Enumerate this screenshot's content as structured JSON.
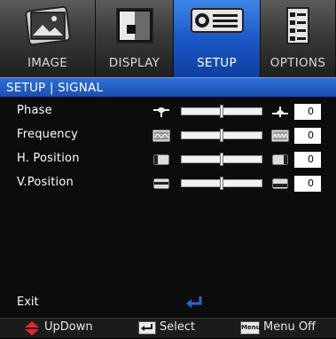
{
  "tabs": [
    {
      "label": "IMAGE",
      "icon": "image-icon"
    },
    {
      "label": "DISPLAY",
      "icon": "display-icon"
    },
    {
      "label": "SETUP",
      "icon": "projector-icon"
    },
    {
      "label": "OPTIONS",
      "icon": "options-icon"
    }
  ],
  "active_tab": "SETUP",
  "section_title": "SETUP | SIGNAL",
  "rows": [
    {
      "label": "Phase",
      "value": "0",
      "level": 0.5,
      "left_icon": "phase-low-icon",
      "right_icon": "phase-high-icon"
    },
    {
      "label": "Frequency",
      "value": "0",
      "level": 0.5,
      "left_icon": "frequency-low-icon",
      "right_icon": "frequency-high-icon"
    },
    {
      "label": "H. Position",
      "value": "0",
      "level": 0.5,
      "left_icon": "h-position-left-icon",
      "right_icon": "h-position-right-icon"
    },
    {
      "label": "V.Position",
      "value": "0",
      "level": 0.5,
      "left_icon": "v-position-down-icon",
      "right_icon": "v-position-up-icon"
    }
  ],
  "exit_label": "Exit",
  "footer": {
    "updown_label": "UpDown",
    "select_label": "Select",
    "menu_key_label": "Menu",
    "menu_off_label": "Menu Off"
  },
  "colors": {
    "accent": "#1b58c8",
    "footer_arrow": "#e8252a",
    "exit_icon": "#2d63d8"
  }
}
